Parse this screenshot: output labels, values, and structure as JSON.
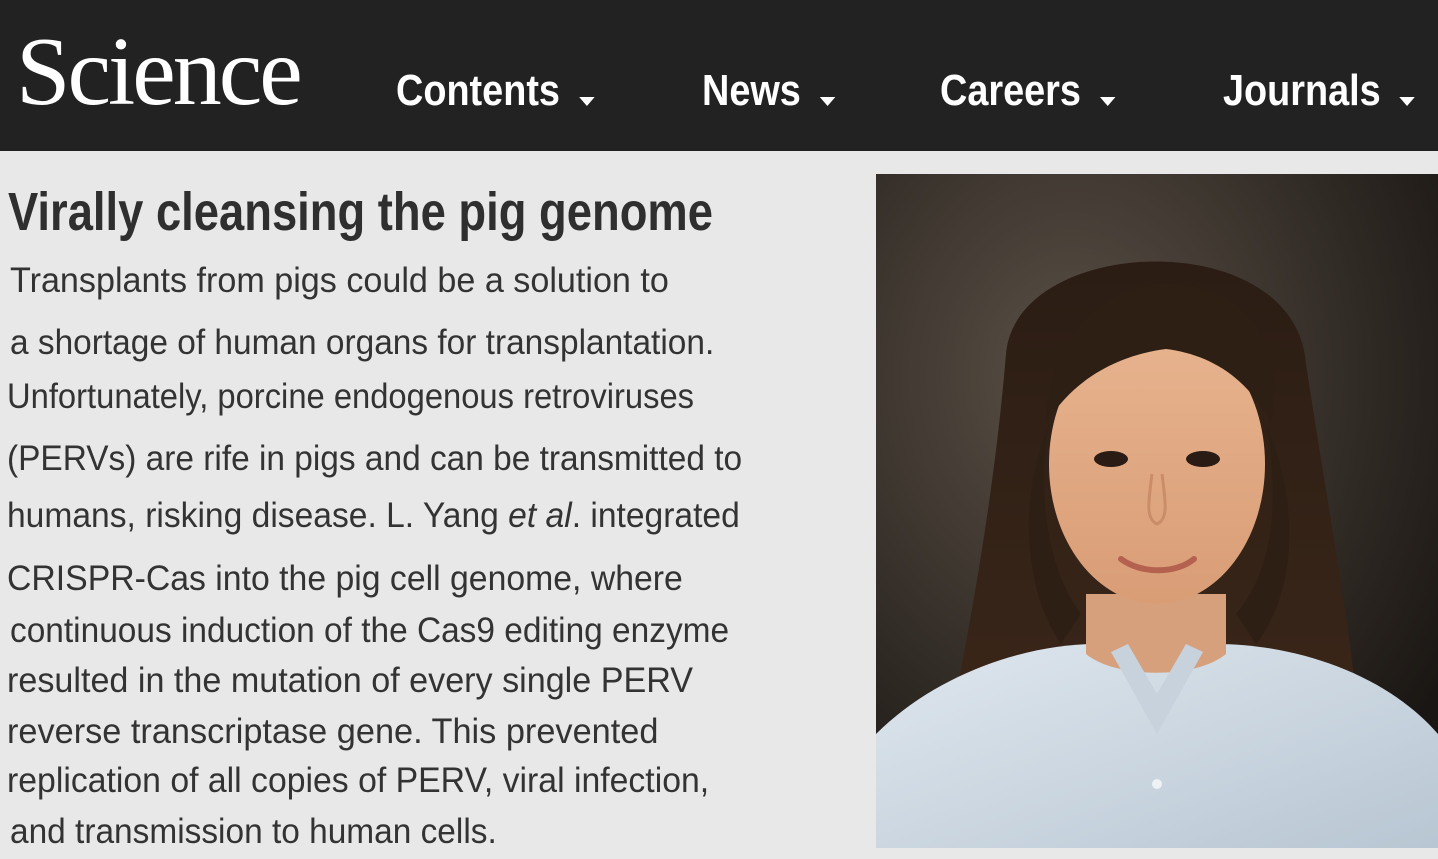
{
  "header": {
    "logo": "Science",
    "nav": [
      {
        "label": "Contents"
      },
      {
        "label": "News"
      },
      {
        "label": "Careers"
      },
      {
        "label": "Journals"
      }
    ]
  },
  "article": {
    "headline": "Virally cleansing the pig genome",
    "lines": [
      {
        "text": "Transplants from pigs could be a solution to"
      },
      {
        "text": "a shortage of human organs for transplantation."
      },
      {
        "text": "Unfortunately,  porcine endogenous retroviruses"
      },
      {
        "text": "(PERVs) are rife in pigs and can be transmitted to"
      },
      {
        "pre": "humans, risking disease. L. Yang ",
        "em": "et al",
        "post": ". integrated"
      },
      {
        "text": "CRISPR-Cas into the pig cell genome, where"
      },
      {
        "text": "continuous induction of the Cas9 editing enzyme"
      },
      {
        "text": "resulted in the mutation of every single PERV"
      },
      {
        "text": "reverse transcriptase gene. This prevented"
      },
      {
        "text": "replication of all copies of PERV, viral infection,"
      },
      {
        "text": "and transmission to human cells."
      }
    ]
  },
  "colors": {
    "header_bg": "#222222",
    "page_bg": "#e8e8e8",
    "headline": "#2f2f2f",
    "body_text": "#333333"
  },
  "icons": {
    "nav_dropdown": "chevron-down-icon"
  },
  "photo": {
    "alt": ""
  }
}
